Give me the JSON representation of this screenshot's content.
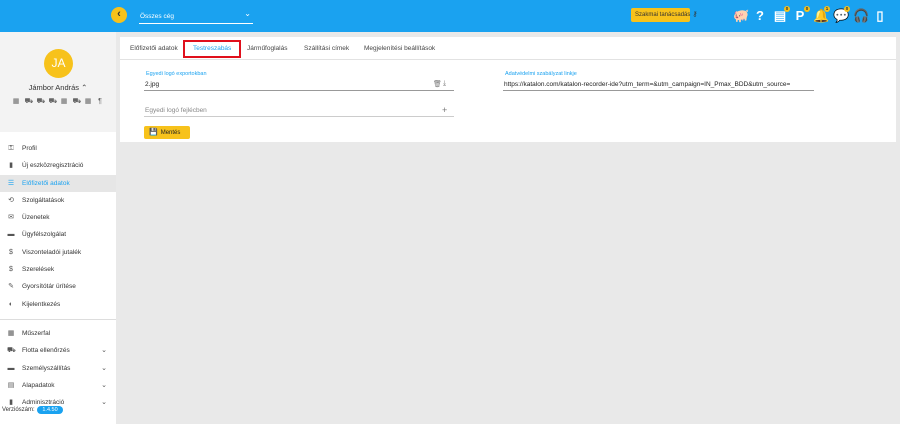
{
  "topbar": {
    "back_icon": "chevron-left-icon",
    "company_select": {
      "value": "Összes cég",
      "chevron": "⌄"
    },
    "advice_button": {
      "label": "Szakmai tanácsadás",
      "icon": "key-icon"
    },
    "icons": [
      {
        "name": "piggy-bank-icon",
        "glyph": "🐖",
        "badge": ""
      },
      {
        "name": "help-icon",
        "glyph": "?",
        "badge": ""
      },
      {
        "name": "document-icon",
        "glyph": "▤",
        "badge": "0"
      },
      {
        "name": "parking-icon",
        "glyph": "P",
        "badge": "0"
      },
      {
        "name": "bell-icon",
        "glyph": "🔔",
        "badge": "1"
      },
      {
        "name": "chat-icon",
        "glyph": "💬",
        "badge": "0"
      },
      {
        "name": "headset-icon",
        "glyph": "🎧",
        "badge": ""
      },
      {
        "name": "phone-download-icon",
        "glyph": "▯",
        "badge": ""
      }
    ]
  },
  "sidebar": {
    "avatar_initials": "JA",
    "user_name": "Jámbor András ⌃",
    "quick_icons": [
      "▦",
      "⛟",
      "⛟",
      "⛟",
      "▦",
      "⛟",
      "▦",
      "¶"
    ],
    "nav_top": [
      {
        "label": "Profil",
        "icon": "user-key-icon",
        "glyph": "⚿"
      },
      {
        "label": "Új eszközregisztráció",
        "icon": "device-icon",
        "glyph": "▮"
      },
      {
        "label": "Előfizetői adatok",
        "icon": "list-icon",
        "glyph": "☰",
        "active": true
      },
      {
        "label": "Szolgáltatások",
        "icon": "services-icon",
        "glyph": "⟲"
      },
      {
        "label": "Üzenetek",
        "icon": "messages-icon",
        "glyph": "✉"
      },
      {
        "label": "Ügyfélszolgálat",
        "icon": "support-icon",
        "glyph": "▬"
      },
      {
        "label": "Viszonteladói jutalék",
        "icon": "dollar-icon",
        "glyph": "$"
      },
      {
        "label": "Szerelések",
        "icon": "install-dollar-icon",
        "glyph": "$"
      },
      {
        "label": "Gyorsítótár ürítése",
        "icon": "broom-icon",
        "glyph": "✎"
      },
      {
        "label": "Kijelentkezés",
        "icon": "logout-icon",
        "glyph": "◐"
      }
    ],
    "nav_bottom": [
      {
        "label": "Műszerfal",
        "icon": "dashboard-icon",
        "glyph": "▦",
        "expand": false
      },
      {
        "label": "Flotta ellenőrzés",
        "icon": "fleet-icon",
        "glyph": "⛟",
        "expand": true
      },
      {
        "label": "Személyszállítás",
        "icon": "bus-icon",
        "glyph": "▬",
        "expand": true
      },
      {
        "label": "Alapadatok",
        "icon": "database-icon",
        "glyph": "▤",
        "expand": true
      },
      {
        "label": "Adminisztráció",
        "icon": "admin-icon",
        "glyph": "▮",
        "expand": true
      }
    ],
    "version_label": "Verziószám:",
    "version": "1.4.50"
  },
  "tabs": [
    {
      "label": "Előfizetői adatok"
    },
    {
      "label": "Testreszabás",
      "active": true
    },
    {
      "label": "Járműfoglalás"
    },
    {
      "label": "Szállítási címek"
    },
    {
      "label": "Megjelenítési beállítások"
    }
  ],
  "form": {
    "logo_export_label": "Egyedi logó exportokban",
    "logo_export_value": "2.jpg",
    "logo_header_placeholder": "Egyedi logó fejlécben",
    "privacy_label": "Adatvédelmi szabályzat linkje",
    "privacy_value": "https://katalon.com/katalon-recorder-ide?utm_term=&utm_campaign=IN_Pmax_BDD&utm_source=",
    "save_label": "Mentés"
  }
}
